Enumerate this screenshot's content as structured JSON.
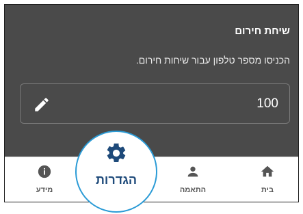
{
  "dialog": {
    "title": "שיחת חירום",
    "description": "הכניסו מספר טלפון עבור שיחות חירום.",
    "phone_value": "100",
    "edit_icon": "pencil-icon"
  },
  "nav": {
    "home": {
      "label": "בית",
      "icon": "home-icon"
    },
    "match": {
      "label": "התאמה",
      "icon": "person-icon"
    },
    "settings": {
      "label": "הגדרות",
      "icon": "gear-icon",
      "active": true
    },
    "info": {
      "label": "מידע",
      "icon": "info-icon"
    }
  },
  "colors": {
    "dialog_bg": "#4a4a4a",
    "accent": "#2b9bd6",
    "active_label": "#1e4a7a"
  }
}
